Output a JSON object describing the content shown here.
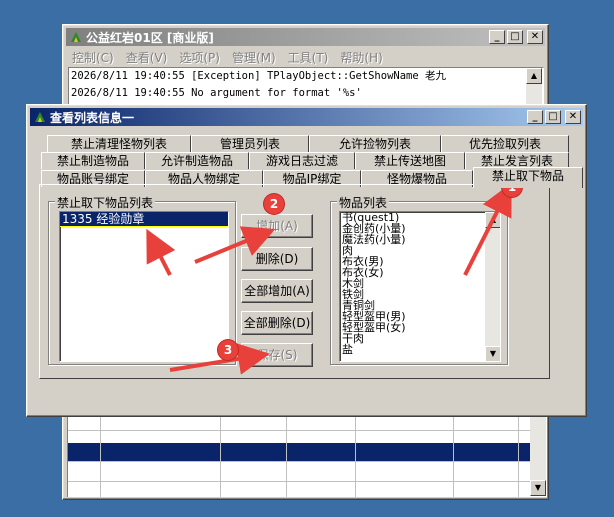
{
  "main_window": {
    "title": "公益红岩01区 [商业版]",
    "menu": [
      "控制(C)",
      "查看(V)",
      "选项(P)",
      "管理(M)",
      "工具(T)",
      "帮助(H)"
    ],
    "log_lines": [
      "2026/8/11 19:40:55 [Exception] TPlayObject::GetShowName 老九",
      "2026/8/11 19:40:55 No argument for format '%s'"
    ]
  },
  "dialog": {
    "title": "查看列表信息一",
    "tabs_row1": [
      "禁止清理怪物列表",
      "管理员列表",
      "允许捡物列表",
      "优先捡取列表"
    ],
    "tabs_row2": [
      "禁止制造物品",
      "允许制造物品",
      "游戏日志过滤",
      "禁止传送地图",
      "禁止发言列表"
    ],
    "tabs_row3": [
      "物品账号绑定",
      "物品人物绑定",
      "物品IP绑定",
      "怪物爆物品",
      "禁止取下物品"
    ],
    "left_group_label": "禁止取下物品列表",
    "left_items": [
      "1335  经验勋章"
    ],
    "right_group_label": "物品列表",
    "right_items": [
      "书(quest1)",
      "金创药(小量)",
      "魔法药(小量)",
      "肉",
      "布衣(男)",
      "布衣(女)",
      "木剑",
      "铁剑",
      "青铜剑",
      "轻型盔甲(男)",
      "轻型盔甲(女)",
      "干肉",
      "盐"
    ],
    "buttons": {
      "add": "增加(A)",
      "delete": "删除(D)",
      "add_all": "全部增加(A)",
      "delete_all": "全部删除(D)",
      "save": "保存(S)"
    }
  },
  "annotations": [
    "1",
    "2",
    "3"
  ],
  "colors": {
    "desktop": "#3a6ea5",
    "title_active": "#0a246a",
    "selection": "#0a246a",
    "annotation": "#e8403a"
  }
}
